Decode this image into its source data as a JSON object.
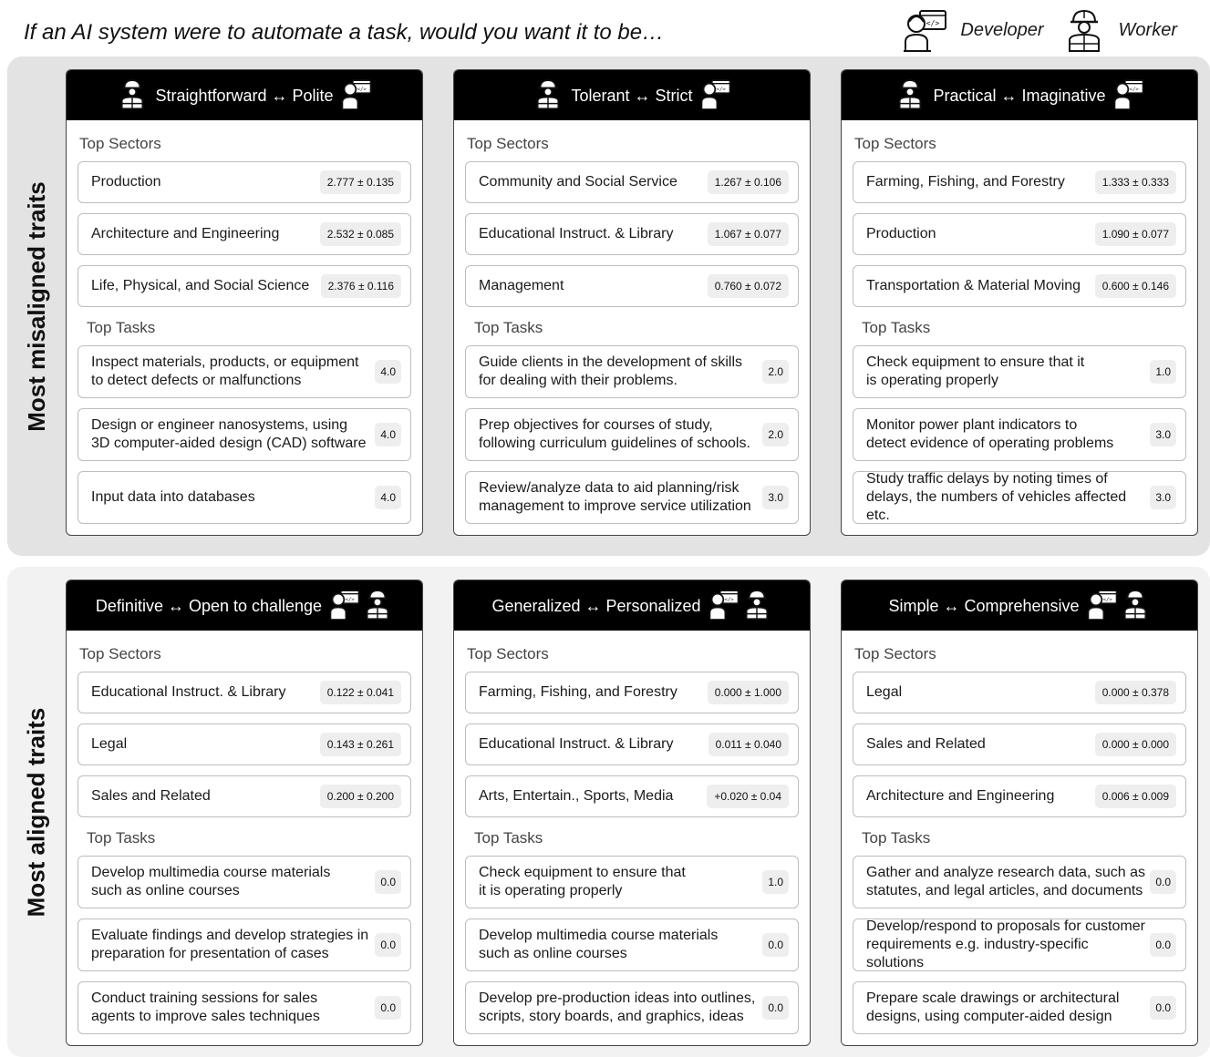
{
  "header": {
    "title": "If an AI system were to automate a task, would you want it to be…"
  },
  "legend": {
    "developer_label": "Developer",
    "developer_icon": "developer-icon",
    "worker_label": "Worker",
    "worker_icon": "worker-icon"
  },
  "section_labels": {
    "sectors": "Top Sectors",
    "tasks": "Top Tasks"
  },
  "panels": [
    {
      "label": "Most misaligned traits",
      "cards": [
        {
          "title": "Straightforward ↔ Polite",
          "sectors": [
            {
              "name": "Production",
              "value": "2.777 ± 0.135"
            },
            {
              "name": "Architecture and Engineering",
              "value": "2.532 ± 0.085"
            },
            {
              "name": "Life, Physical, and Social Science",
              "value": "2.376 ± 0.116"
            }
          ],
          "tasks": [
            {
              "line1": "Inspect materials, products, or equipment",
              "line2": "to detect defects or malfunctions",
              "value": "4.0"
            },
            {
              "line1": "Design or engineer nanosystems, using",
              "line2": "3D computer-aided design (CAD) software",
              "value": "4.0"
            },
            {
              "line1": "Input data into databases",
              "line2": "",
              "value": "4.0"
            }
          ]
        },
        {
          "title": "Tolerant ↔ Strict",
          "sectors": [
            {
              "name": "Community and Social Service",
              "value": "1.267 ± 0.106"
            },
            {
              "name": "Educational Instruct. & Library",
              "value": "1.067 ± 0.077"
            },
            {
              "name": "Management",
              "value": "0.760 ± 0.072"
            }
          ],
          "tasks": [
            {
              "line1": "Guide clients in the development of skills",
              "line2": "for dealing with their problems.",
              "value": "2.0"
            },
            {
              "line1": "Prep objectives for courses of study,",
              "line2": "following curriculum guidelines of schools.",
              "value": "2.0"
            },
            {
              "line1": "Review/analyze data to aid planning/risk",
              "line2": "management to improve service utilization",
              "value": "3.0"
            }
          ]
        },
        {
          "title": "Practical ↔ Imaginative",
          "sectors": [
            {
              "name": "Farming, Fishing, and Forestry",
              "value": "1.333 ± 0.333"
            },
            {
              "name": "Production",
              "value": "1.090 ± 0.077"
            },
            {
              "name": "Transportation & Material Moving",
              "value": "0.600 ± 0.146"
            }
          ],
          "tasks": [
            {
              "line1": "Check equipment to ensure that it",
              "line2": "is operating properly",
              "value": "1.0"
            },
            {
              "line1": "Monitor power plant indicators to",
              "line2": "detect evidence of operating problems",
              "value": "3.0"
            },
            {
              "line1": "Study traffic delays by noting times of",
              "line2": "delays, the numbers of vehicles affected etc.",
              "value": "3.0"
            }
          ]
        }
      ]
    },
    {
      "label": "Most aligned traits",
      "cards": [
        {
          "title": "Definitive ↔ Open to challenge",
          "sectors": [
            {
              "name": "Educational Instruct. & Library",
              "value": "0.122 ± 0.041"
            },
            {
              "name": "Legal",
              "value": "0.143 ± 0.261"
            },
            {
              "name": "Sales and Related",
              "value": "0.200 ± 0.200"
            }
          ],
          "tasks": [
            {
              "line1": "Develop multimedia course materials",
              "line2": "such as online courses",
              "value": "0.0"
            },
            {
              "line1": "Evaluate findings and develop strategies in",
              "line2": "preparation for presentation of cases",
              "value": "0.0"
            },
            {
              "line1": "Conduct training sessions for sales",
              "line2": "agents to improve sales techniques",
              "value": "0.0"
            }
          ]
        },
        {
          "title": "Generalized ↔ Personalized",
          "sectors": [
            {
              "name": "Farming, Fishing, and Forestry",
              "value": "0.000 ± 1.000"
            },
            {
              "name": "Educational Instruct. & Library",
              "value": "0.011 ± 0.040"
            },
            {
              "name": "Arts, Entertain., Sports, Media",
              "value": "+0.020 ± 0.04"
            }
          ],
          "tasks": [
            {
              "line1": "Check equipment to ensure that",
              "line2": "it is operating properly",
              "value": "1.0"
            },
            {
              "line1": "Develop multimedia course materials",
              "line2": "such as online courses",
              "value": "0.0"
            },
            {
              "line1": "Develop pre-production ideas into outlines,",
              "line2": "scripts, story boards, and graphics, ideas",
              "value": "0.0"
            }
          ]
        },
        {
          "title": "Simple ↔ Comprehensive",
          "sectors": [
            {
              "name": "Legal",
              "value": "0.000 ± 0.378"
            },
            {
              "name": "Sales and Related",
              "value": "0.000 ± 0.000"
            },
            {
              "name": "Architecture and Engineering",
              "value": "0.006 ± 0.009"
            }
          ],
          "tasks": [
            {
              "line1": "Gather and analyze research data, such as",
              "line2": "statutes, and legal articles, and documents",
              "value": "0.0"
            },
            {
              "line1": "Develop/respond to proposals for customer",
              "line2": "requirements e.g. industry-specific solutions",
              "value": "0.0"
            },
            {
              "line1": "Prepare scale drawings or architectural",
              "line2": "designs, using computer-aided design",
              "value": "0.0"
            }
          ]
        }
      ]
    }
  ]
}
